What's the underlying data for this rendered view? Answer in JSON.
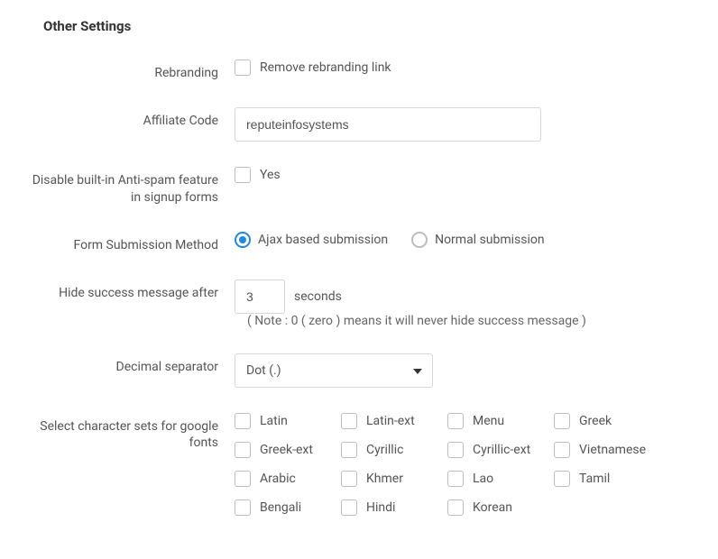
{
  "section_title": "Other Settings",
  "rows": {
    "rebranding": {
      "label": "Rebranding",
      "checkbox_label": "Remove rebranding link"
    },
    "affiliate": {
      "label": "Affiliate Code",
      "value": "reputeinfosystems"
    },
    "antispam": {
      "label": "Disable built-in Anti-spam feature in signup forms",
      "checkbox_label": "Yes"
    },
    "submission": {
      "label": "Form Submission Method",
      "options": [
        "Ajax based submission",
        "Normal submission"
      ],
      "selected": "Ajax based submission"
    },
    "hide_after": {
      "label": "Hide success message after",
      "value": "3",
      "unit": "seconds",
      "note": "( Note : 0 ( zero ) means it will never hide success message )"
    },
    "decimal": {
      "label": "Decimal separator",
      "selected": "Dot (.)"
    },
    "charsets": {
      "label": "Select character sets for google fonts",
      "grid": [
        [
          "Latin",
          "Latin-ext",
          "Menu",
          "Greek"
        ],
        [
          "Greek-ext",
          "Cyrillic",
          "Cyrillic-ext",
          "Vietnamese"
        ],
        [
          "Arabic",
          "Khmer",
          "Lao",
          "Tamil"
        ],
        [
          "Bengali",
          "Hindi",
          "Korean",
          ""
        ]
      ]
    }
  }
}
